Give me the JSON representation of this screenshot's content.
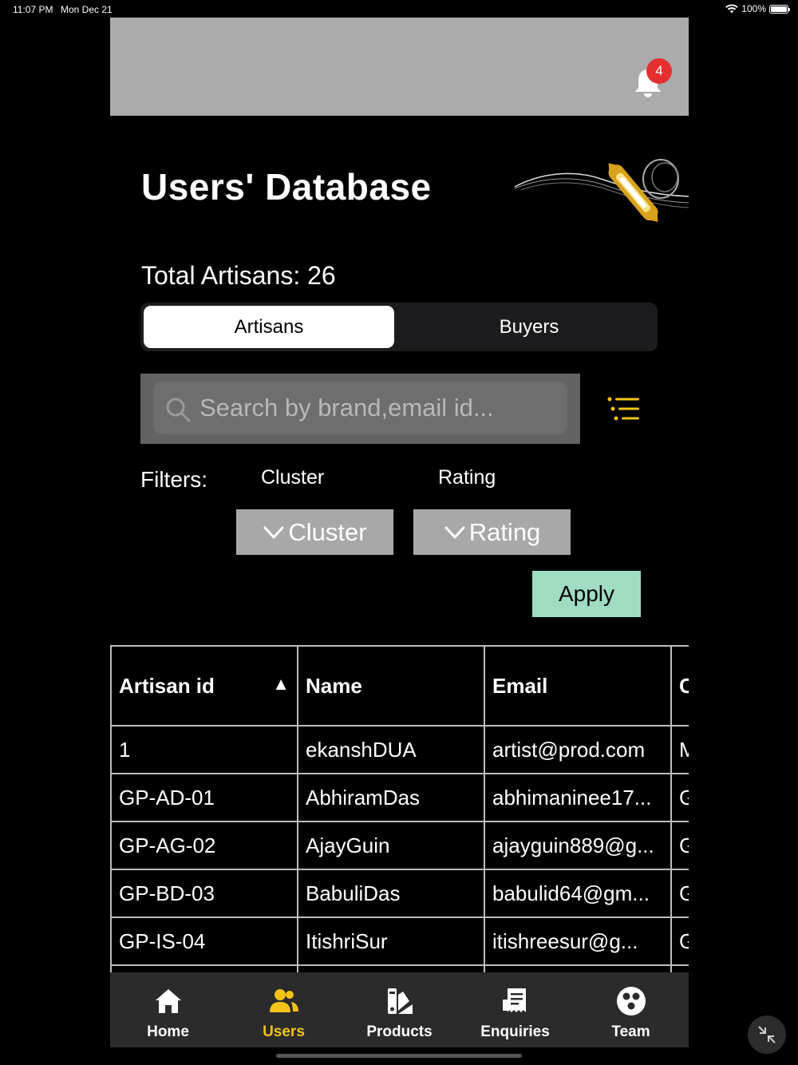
{
  "status_bar": {
    "time": "11:07 PM",
    "date": "Mon Dec 21",
    "battery": "100%"
  },
  "header": {
    "notification_count": "4"
  },
  "page": {
    "title": "Users' Database",
    "total_label": "Total Artisans: 26"
  },
  "segments": {
    "active": "Artisans",
    "inactive": "Buyers"
  },
  "search": {
    "placeholder": "Search by brand,email id...",
    "value": ""
  },
  "filters": {
    "label": "Filters:",
    "cluster_heading": "Cluster",
    "rating_heading": "Rating",
    "cluster_dropdown": "Cluster",
    "rating_dropdown": "Rating",
    "apply_label": "Apply"
  },
  "table": {
    "columns": [
      "Artisan id",
      "Name",
      "Email",
      "C"
    ],
    "sort_indicator": "▲",
    "rows": [
      [
        "1",
        "ekanshDUA",
        "artist@prod.com",
        "M"
      ],
      [
        "GP-AD-01",
        "AbhiramDas",
        "abhimaninee17...",
        "G"
      ],
      [
        "GP-AG-02",
        "AjayGuin",
        "ajayguin889@g...",
        "G"
      ],
      [
        "GP-BD-03",
        "BabuliDas",
        "babulid64@gm...",
        "G"
      ],
      [
        "GP-IS-04",
        "ItishriSur",
        "itishreesur@g...",
        "G"
      ]
    ]
  },
  "tabs": [
    {
      "label": "Home",
      "icon": "home-icon"
    },
    {
      "label": "Users",
      "icon": "users-icon"
    },
    {
      "label": "Products",
      "icon": "products-icon"
    },
    {
      "label": "Enquiries",
      "icon": "enquiries-icon"
    },
    {
      "label": "Team",
      "icon": "team-icon"
    }
  ],
  "colors": {
    "accent": "#f4c318",
    "apply": "#9fdcc1",
    "badge": "#e53030",
    "banner": "#ababab"
  }
}
